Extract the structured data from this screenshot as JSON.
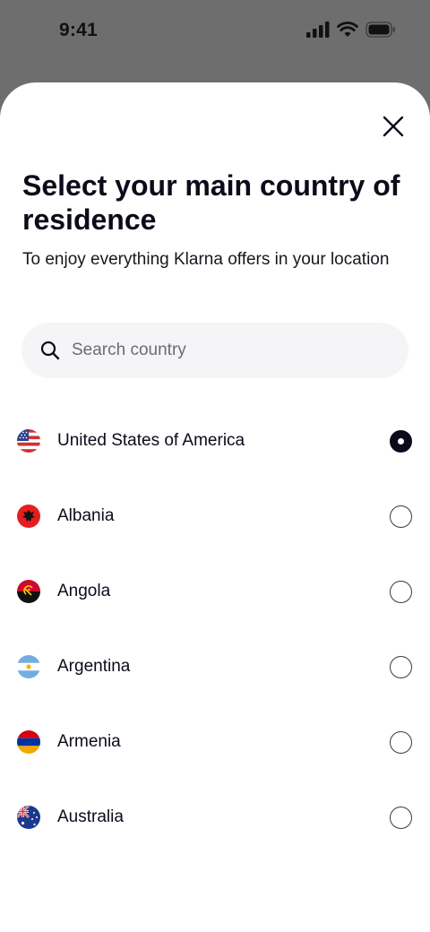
{
  "status_bar": {
    "time": "9:41"
  },
  "sheet": {
    "title": "Select your main country of residence",
    "subtitle": "To enjoy everything Klarna offers in your location",
    "search": {
      "placeholder": "Search country",
      "value": ""
    }
  },
  "countries": [
    {
      "name": "United States of America",
      "flag": "us-flag-icon",
      "selected": true
    },
    {
      "name": "Albania",
      "flag": "albania-flag-icon",
      "selected": false
    },
    {
      "name": "Angola",
      "flag": "angola-flag-icon",
      "selected": false
    },
    {
      "name": "Argentina",
      "flag": "argentina-flag-icon",
      "selected": false
    },
    {
      "name": "Armenia",
      "flag": "armenia-flag-icon",
      "selected": false
    },
    {
      "name": "Australia",
      "flag": "australia-flag-icon",
      "selected": false
    }
  ],
  "colors": {
    "backdrop": "#6e6e6e",
    "text_primary": "#0b0b1a",
    "search_bg": "#f5f5f7",
    "radio_selected": "#0b0b1a"
  }
}
